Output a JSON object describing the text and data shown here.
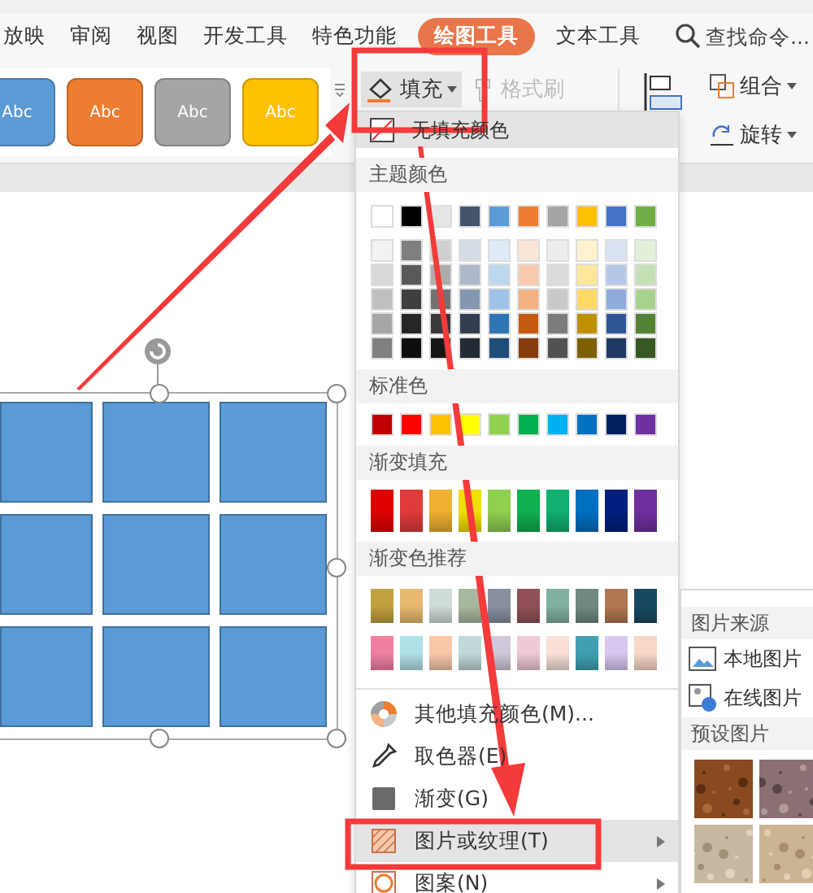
{
  "tabs": [
    {
      "label": "放映",
      "selected": false
    },
    {
      "label": "审阅",
      "selected": false
    },
    {
      "label": "视图",
      "selected": false
    },
    {
      "label": "开发工具",
      "selected": false
    },
    {
      "label": "特色功能",
      "selected": false
    },
    {
      "label": "绘图工具",
      "selected": true
    },
    {
      "label": "文本工具",
      "selected": false
    }
  ],
  "search": {
    "placeholder": "查找命令..."
  },
  "style_gallery": [
    {
      "label": "Abc",
      "color": "#5b9bd5"
    },
    {
      "label": "Abc",
      "color": "#ed7d31"
    },
    {
      "label": "Abc",
      "color": "#a5a5a5"
    },
    {
      "label": "Abc",
      "color": "#ffc000"
    }
  ],
  "ribbon": {
    "fill_button": {
      "label": "填充",
      "pressed": true
    },
    "format_painter": {
      "label": "格式刷",
      "disabled": true
    },
    "group_button": {
      "label": "组合"
    },
    "rotate_button": {
      "label": "旋转"
    }
  },
  "fill_menu": {
    "no_fill": {
      "label": "无填充颜色",
      "selected": true
    },
    "theme_title": "主题颜色",
    "theme_colors": [
      {
        "color": "#ffffff"
      },
      {
        "color": "#000000"
      },
      {
        "color": "#e7e6e6"
      },
      {
        "color": "#44546a"
      },
      {
        "color": "#5b9bd5"
      },
      {
        "color": "#ed7d31"
      },
      {
        "color": "#a5a5a5"
      },
      {
        "color": "#ffc000"
      },
      {
        "color": "#4472c4"
      },
      {
        "color": "#70ad47"
      }
    ],
    "theme_shades": [
      [
        {
          "color": "#f2f2f2"
        },
        {
          "color": "#7f7f7f"
        },
        {
          "color": "#d0cece"
        },
        {
          "color": "#d6dce5"
        },
        {
          "color": "#deebf7"
        },
        {
          "color": "#fbe5d6"
        },
        {
          "color": "#ededed"
        },
        {
          "color": "#fff2cc"
        },
        {
          "color": "#dae3f3"
        },
        {
          "color": "#e2f0d9"
        }
      ],
      [
        {
          "color": "#d9d9d9"
        },
        {
          "color": "#595959"
        },
        {
          "color": "#aeabab"
        },
        {
          "color": "#adb9ca"
        },
        {
          "color": "#bdd7ee"
        },
        {
          "color": "#f8cbad"
        },
        {
          "color": "#dbdbdb"
        },
        {
          "color": "#ffe699"
        },
        {
          "color": "#b4c7e7"
        },
        {
          "color": "#c5e0b4"
        }
      ],
      [
        {
          "color": "#bfbfbf"
        },
        {
          "color": "#3f3f3f"
        },
        {
          "color": "#757171"
        },
        {
          "color": "#8497b0"
        },
        {
          "color": "#9dc3e6"
        },
        {
          "color": "#f4b183"
        },
        {
          "color": "#c9c9c9"
        },
        {
          "color": "#ffd966"
        },
        {
          "color": "#8faadc"
        },
        {
          "color": "#a9d18e"
        }
      ],
      [
        {
          "color": "#a6a6a6"
        },
        {
          "color": "#262626"
        },
        {
          "color": "#3a3838"
        },
        {
          "color": "#333f50"
        },
        {
          "color": "#2e75b6"
        },
        {
          "color": "#c55a11"
        },
        {
          "color": "#7c7c7c"
        },
        {
          "color": "#bf9000"
        },
        {
          "color": "#2f5597"
        },
        {
          "color": "#548235"
        }
      ],
      [
        {
          "color": "#808080"
        },
        {
          "color": "#0d0d0d"
        },
        {
          "color": "#171616"
        },
        {
          "color": "#222a35"
        },
        {
          "color": "#1f4e79"
        },
        {
          "color": "#843c0c"
        },
        {
          "color": "#525252"
        },
        {
          "color": "#7f6000"
        },
        {
          "color": "#203864"
        },
        {
          "color": "#385723"
        }
      ]
    ],
    "standard_title": "标准色",
    "standard_colors": [
      {
        "color": "#c00000"
      },
      {
        "color": "#ff0000"
      },
      {
        "color": "#ffc000"
      },
      {
        "color": "#ffff00"
      },
      {
        "color": "#92d050"
      },
      {
        "color": "#00b050"
      },
      {
        "color": "#00b0f0"
      },
      {
        "color": "#0070c0"
      },
      {
        "color": "#002060"
      },
      {
        "color": "#7030a0"
      }
    ],
    "gradient_title": "渐变填充",
    "gradient_colors": [
      {
        "color": "#e00000"
      },
      {
        "color": "#e03a3a"
      },
      {
        "color": "#f0b030"
      },
      {
        "color": "#f0e000"
      },
      {
        "color": "#8fd050"
      },
      {
        "color": "#10b050"
      },
      {
        "color": "#10b070"
      },
      {
        "color": "#0070c0"
      },
      {
        "color": "#00207f"
      },
      {
        "color": "#7030a0"
      }
    ],
    "recommended_title": "渐变色推荐",
    "recommended_colors": [
      [
        {
          "color": "#c0a040"
        },
        {
          "color": "#e8b870"
        },
        {
          "color": "#d0dcd8"
        },
        {
          "color": "#a8b8a0"
        },
        {
          "color": "#8890a0"
        },
        {
          "color": "#905058"
        },
        {
          "color": "#80b0a0"
        },
        {
          "color": "#708880"
        },
        {
          "color": "#b07850"
        },
        {
          "color": "#184860"
        }
      ],
      [
        {
          "color": "#f080a0"
        },
        {
          "color": "#b0e0e8"
        },
        {
          "color": "#f8c8a8"
        },
        {
          "color": "#c0d8d8"
        },
        {
          "color": "#d0c8d8"
        },
        {
          "color": "#f0c8d8"
        },
        {
          "color": "#f8e0d8"
        },
        {
          "color": "#40a0b0"
        },
        {
          "color": "#d8c8f0"
        },
        {
          "color": "#f8d8c8"
        }
      ]
    ],
    "items": [
      {
        "label": "其他填充颜色(M)...",
        "kind": "palette",
        "submenu": false,
        "selected": false
      },
      {
        "label": "取色器(E)",
        "kind": "eyedropper",
        "submenu": false,
        "selected": false
      },
      {
        "label": "渐变(G)",
        "kind": "gradient",
        "submenu": false,
        "selected": false
      },
      {
        "label": "图片或纹理(T)",
        "kind": "texture",
        "submenu": true,
        "selected": true
      },
      {
        "label": "图案(N)",
        "kind": "pattern",
        "submenu": true,
        "selected": false
      }
    ]
  },
  "picture_submenu": {
    "source_title": "图片来源",
    "items": [
      {
        "label": "本地图片",
        "kind": "local"
      },
      {
        "label": "在线图片",
        "kind": "online"
      }
    ],
    "preset_title": "预设图片"
  }
}
